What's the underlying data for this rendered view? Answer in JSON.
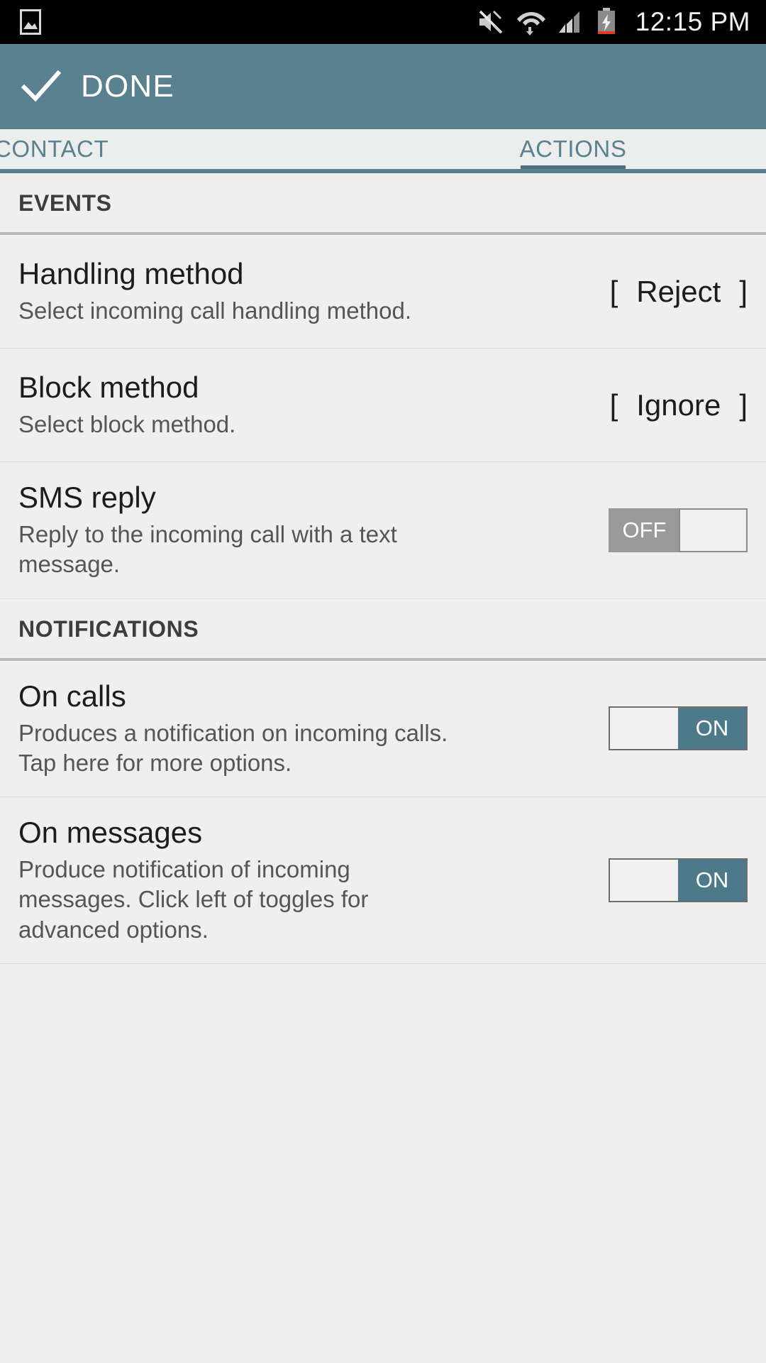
{
  "status_bar": {
    "icons": [
      "image-icon",
      "mute-icon",
      "wifi-icon",
      "signal-icon",
      "battery-charging-icon"
    ],
    "clock": "12:15 PM"
  },
  "action_bar": {
    "icon": "check-icon",
    "title": "DONE",
    "color": "#5a8190"
  },
  "tabs": [
    {
      "label": "CONTACT",
      "selected": false
    },
    {
      "label": "ACTIONS",
      "selected": true
    }
  ],
  "sections": [
    {
      "header": "EVENTS",
      "rows": [
        {
          "title": "Handling method",
          "subtitle": "Select incoming call handling method.",
          "widget": "bracket",
          "bracket_open": "[",
          "bracket_close": "]",
          "value": "Reject"
        },
        {
          "title": "Block method",
          "subtitle": "Select block method.",
          "widget": "bracket",
          "bracket_open": "[",
          "bracket_close": "]",
          "value": "Ignore"
        },
        {
          "title": "SMS reply",
          "subtitle": "Reply to the incoming call with a text message.",
          "widget": "toggle",
          "state": "off",
          "value": "OFF"
        }
      ]
    },
    {
      "header": "NOTIFICATIONS",
      "rows": [
        {
          "title": "On calls",
          "subtitle": "Produces a notification on incoming calls. Tap here for more options.",
          "widget": "toggle",
          "state": "on",
          "value": "ON"
        },
        {
          "title": "On messages",
          "subtitle": "Produce notification of incoming messages. Click left of toggles for advanced options.",
          "widget": "toggle",
          "state": "on",
          "value": "ON"
        }
      ]
    }
  ],
  "colors": {
    "accent_teal": "#5a8190",
    "toggle_on": "#4d7a8a",
    "toggle_off": "#9a9a9a",
    "background": "#efefef"
  }
}
